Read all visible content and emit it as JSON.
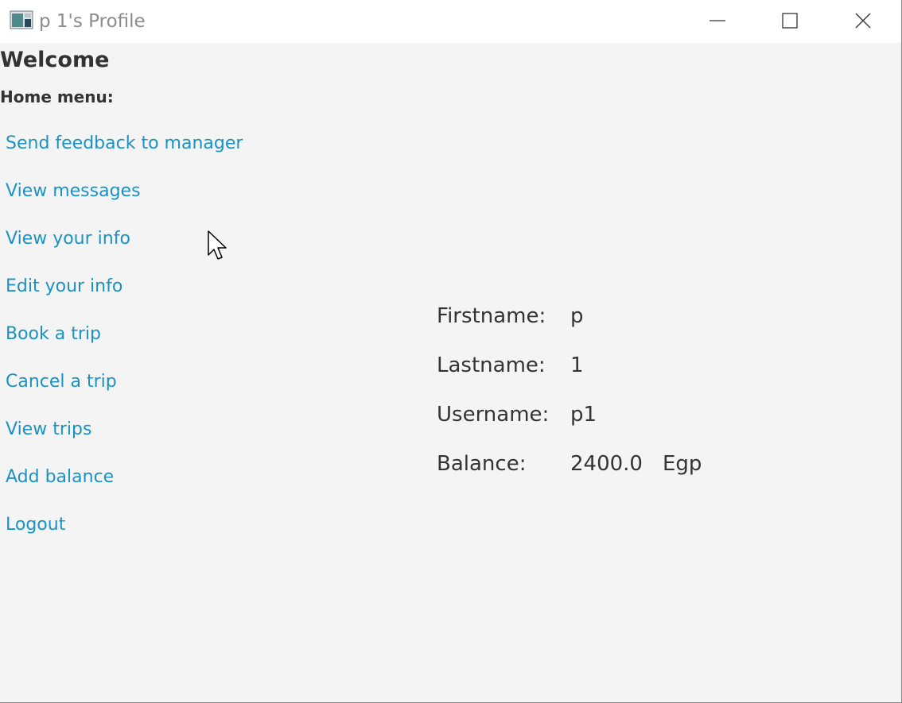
{
  "window": {
    "title": "p 1's Profile",
    "icon": "java-app-icon"
  },
  "window_controls": {
    "minimize_icon": "minimize-icon",
    "maximize_icon": "maximize-icon",
    "close_icon": "close-icon"
  },
  "main": {
    "welcome": "Welcome",
    "home_menu_label": "Home menu:",
    "menu_items": [
      "Send feedback to manager",
      "View messages",
      "View your info",
      "Edit your info",
      "Book a trip",
      "Cancel a trip",
      "View trips",
      "Add balance",
      "Logout"
    ]
  },
  "info": {
    "firstname_label": "Firstname:",
    "firstname_value": "p",
    "lastname_label": "Lastname:",
    "lastname_value": "1",
    "username_label": "Username:",
    "username_value": "p1",
    "balance_label": "Balance:",
    "balance_value": "2400.0",
    "balance_unit": "Egp"
  },
  "colors": {
    "link": "#1a92c4",
    "text": "#333333",
    "background": "#f4f4f4",
    "titlebar": "#ffffff"
  }
}
